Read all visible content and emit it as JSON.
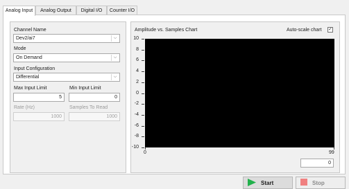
{
  "tabs": [
    {
      "label": "Analog Input",
      "active": true
    },
    {
      "label": "Analog Output",
      "active": false
    },
    {
      "label": "Digital I/O",
      "active": false
    },
    {
      "label": "Counter I/O",
      "active": false
    }
  ],
  "settings": {
    "channel_name": {
      "label": "Channel Name",
      "value": "Dev2/ai7"
    },
    "mode": {
      "label": "Mode",
      "value": "On Demand"
    },
    "input_configuration": {
      "label": "Input Configuration",
      "value": "Differential"
    },
    "max_input_limit": {
      "label": "Max Input Limit",
      "value": "5"
    },
    "min_input_limit": {
      "label": "Min Input Limit",
      "value": "0"
    },
    "rate": {
      "label": "Rate (Hz)",
      "value": "1000"
    },
    "samples_to_read": {
      "label": "Samples To Read",
      "value": "1000"
    }
  },
  "chart": {
    "title": "Amplitude vs. Samples Chart",
    "autoscale_label": "Auto-scale chart",
    "autoscale_checked": true,
    "x_readout": "0"
  },
  "chart_data": {
    "type": "line",
    "title": "Amplitude vs. Samples Chart",
    "xlabel": "",
    "ylabel": "",
    "xlim": [
      0,
      99
    ],
    "ylim": [
      -10,
      10
    ],
    "x_ticks": [
      "0",
      "99"
    ],
    "y_ticks": [
      "10",
      "8",
      "6",
      "4",
      "2",
      "0",
      "-2",
      "-4",
      "-6",
      "-8",
      "-10"
    ],
    "series": [],
    "grid": false,
    "background": "#000000"
  },
  "buttons": {
    "start": {
      "label": "Start",
      "icon": "play-icon",
      "color": "#22b14c"
    },
    "stop": {
      "label": "Stop",
      "icon": "stop-icon",
      "color": "#f08080"
    }
  }
}
